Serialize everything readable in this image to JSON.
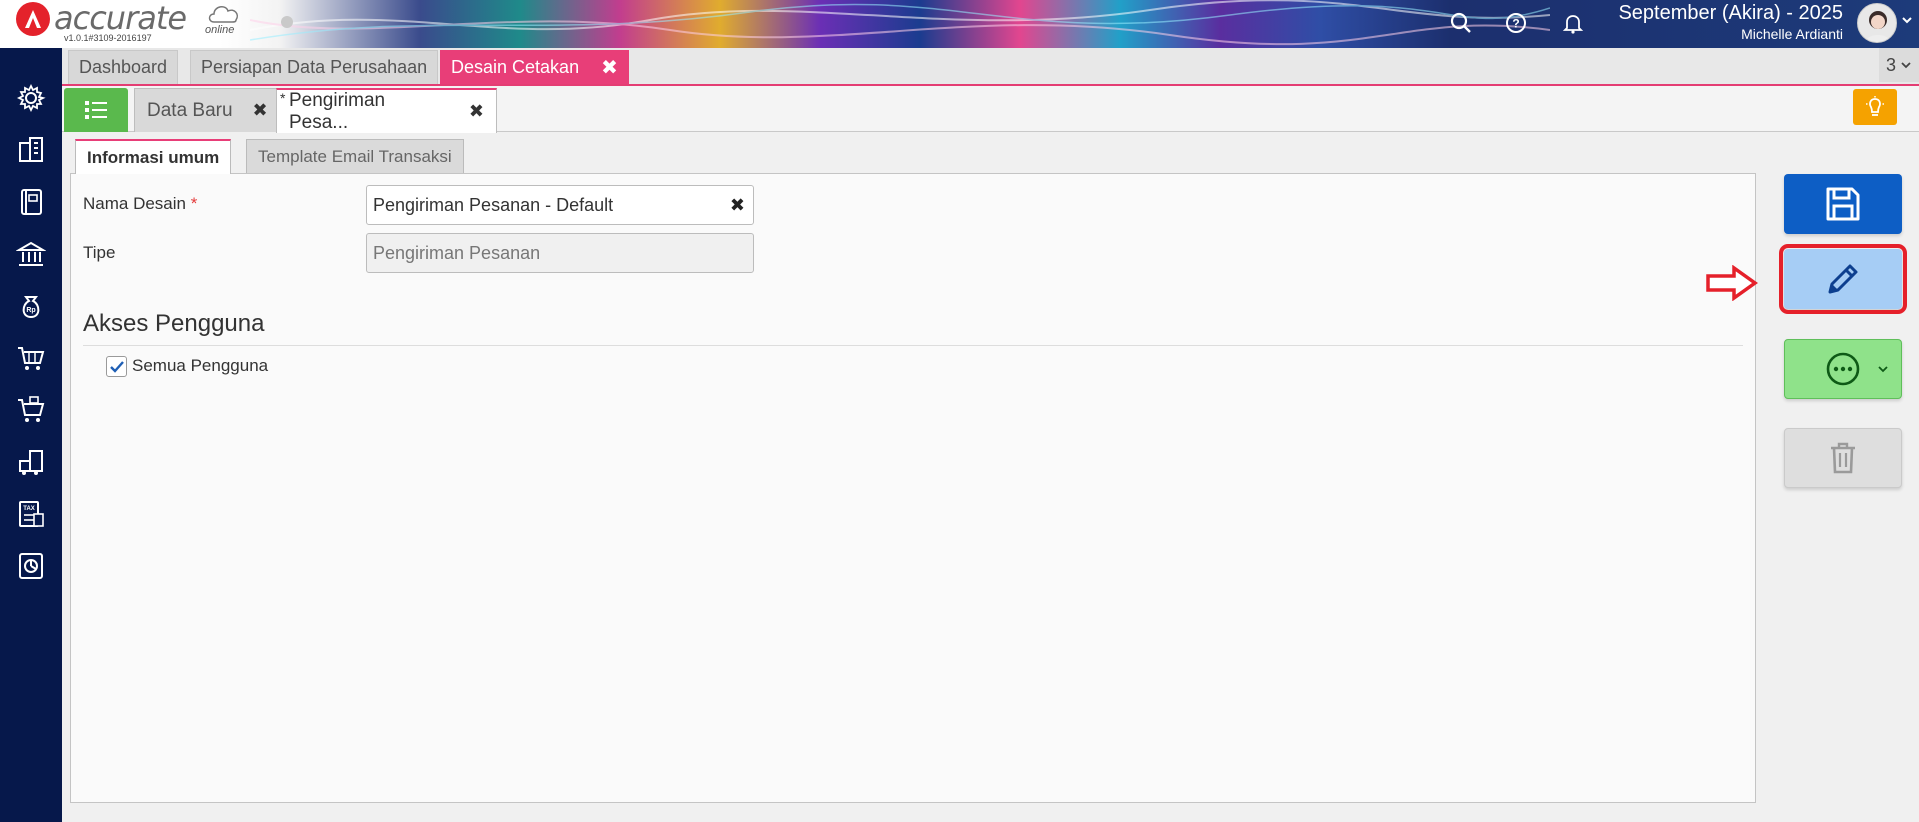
{
  "header": {
    "logo_text": "accurate",
    "logo_sub": "online",
    "version": "v1.0.1#3109-2016197",
    "period": "September (Akira) - 2025",
    "user": "Michelle Ardianti",
    "icons": [
      "search-icon",
      "help-icon",
      "bell-icon"
    ]
  },
  "sidebar": {
    "items": [
      "settings",
      "company",
      "ledger",
      "bank",
      "receivables",
      "sales",
      "purchases",
      "inventory",
      "tax",
      "reports"
    ]
  },
  "module_tabs": {
    "items": [
      "Dashboard",
      "Persiapan Data Perusahaan",
      "Desain Cetakan"
    ],
    "active": "Desain Cetakan",
    "count": "3"
  },
  "sub_tabs": {
    "new_data": "Data Baru",
    "current": "Pengiriman Pesa...",
    "modified_marker": "*"
  },
  "form_tabs": [
    "Informasi umum",
    "Template Email Transaksi"
  ],
  "form": {
    "nama_desain_label": "Nama Desain",
    "required_marker": "*",
    "nama_desain_value": "Pengiriman Pesanan - Default",
    "tipe_label": "Tipe",
    "tipe_value": "Pengiriman Pesanan",
    "section_title": "Akses Pengguna",
    "semua_pengguna_label": "Semua Pengguna",
    "semua_pengguna_checked": true
  },
  "actions": [
    "save",
    "edit",
    "more",
    "delete"
  ],
  "colors": {
    "accent_pink": "#e83e78",
    "sidebar": "#06184b",
    "save": "#0d5ec5",
    "edit": "#a6cdf5",
    "more": "#8fe28a",
    "highlight": "#e5202a"
  }
}
